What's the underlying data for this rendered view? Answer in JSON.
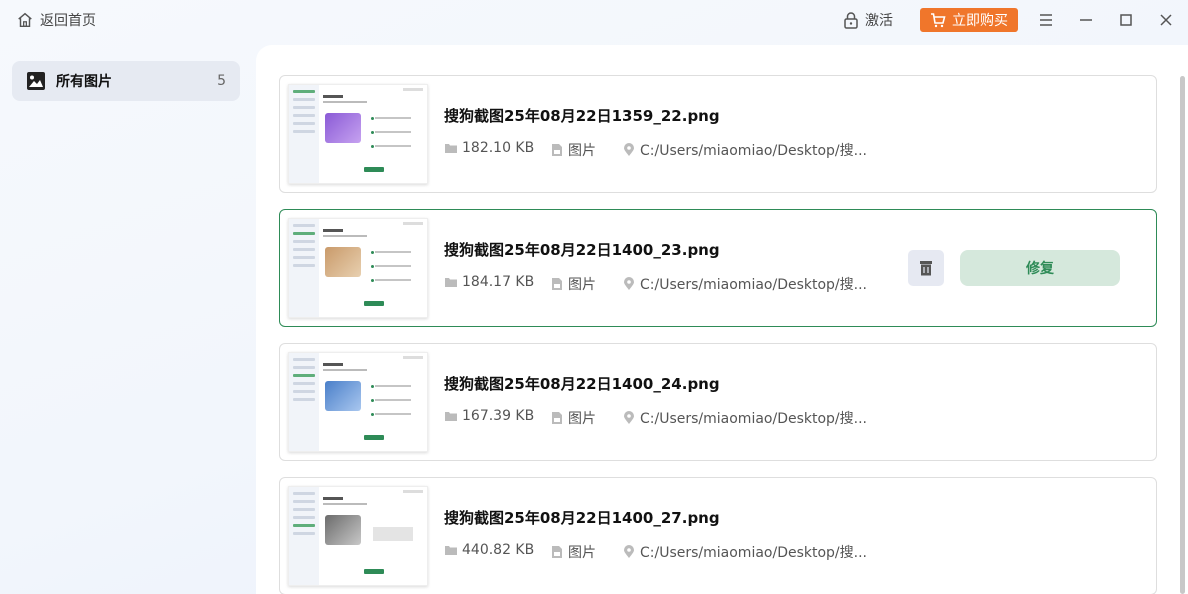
{
  "titlebar": {
    "back_label": "返回首页",
    "activate_label": "激活",
    "buy_label": "立即购买"
  },
  "colors": {
    "accent_green": "#2e8b57",
    "buy_orange": "#f0762b"
  },
  "sidebar": {
    "items": [
      {
        "label": "所有图片",
        "count": "5",
        "icon": "image-icon"
      }
    ]
  },
  "files": [
    {
      "name": "搜狗截图25年08月22日1359_22.png",
      "size": "182.10 KB",
      "type": "图片",
      "path": "C:/Users/miaomiao/Desktop/搜..."
    },
    {
      "name": "搜狗截图25年08月22日1400_23.png",
      "size": "184.17 KB",
      "type": "图片",
      "path": "C:/Users/miaomiao/Desktop/搜..."
    },
    {
      "name": "搜狗截图25年08月22日1400_24.png",
      "size": "167.39 KB",
      "type": "图片",
      "path": "C:/Users/miaomiao/Desktop/搜..."
    },
    {
      "name": "搜狗截图25年08月22日1400_27.png",
      "size": "440.82 KB",
      "type": "图片",
      "path": "C:/Users/miaomiao/Desktop/搜..."
    }
  ],
  "selected_card": {
    "repair_label": "修复"
  }
}
